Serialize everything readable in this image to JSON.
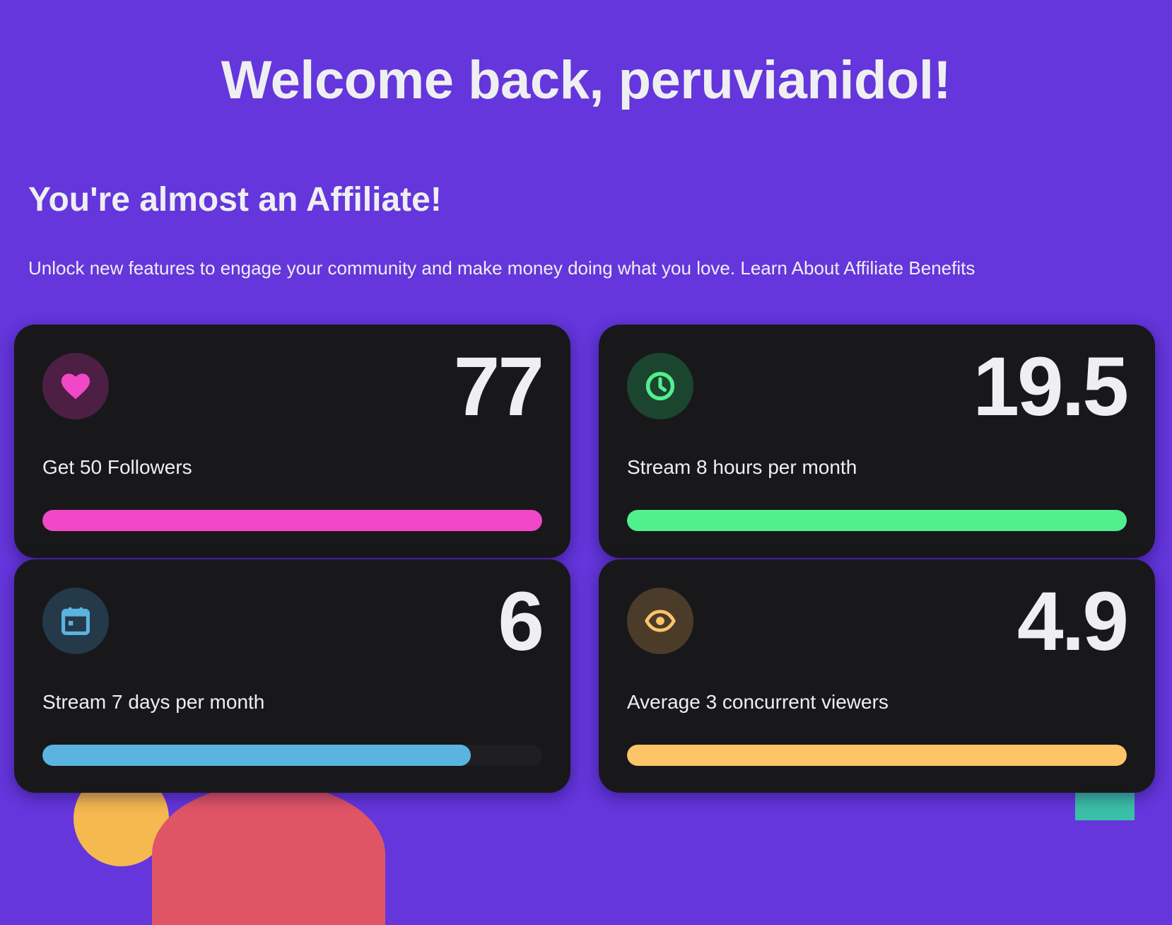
{
  "header": {
    "welcome": "Welcome back, peruvianidol!"
  },
  "affiliate": {
    "title": "You're almost an Affiliate!",
    "description": "Unlock new features to engage your community and make money doing what you love.",
    "link_label": "Learn About Affiliate Benefits"
  },
  "cards": [
    {
      "icon": "heart-icon",
      "value": "77",
      "label": "Get 50 Followers",
      "progress": 1.0,
      "color": "#f048c6",
      "icon_bg": "#4d1f44"
    },
    {
      "icon": "clock-icon",
      "value": "19.5",
      "label": "Stream 8 hours per month",
      "progress": 1.0,
      "color": "#51f08e",
      "icon_bg": "#1c4530"
    },
    {
      "icon": "calendar-icon",
      "value": "6",
      "label": "Stream 7 days per month",
      "progress": 0.857,
      "color": "#5ab4df",
      "icon_bg": "#24394a"
    },
    {
      "icon": "eye-icon",
      "value": "4.9",
      "label": "Average 3 concurrent viewers",
      "progress": 1.0,
      "color": "#fdc468",
      "icon_bg": "#4b3c2a"
    }
  ]
}
